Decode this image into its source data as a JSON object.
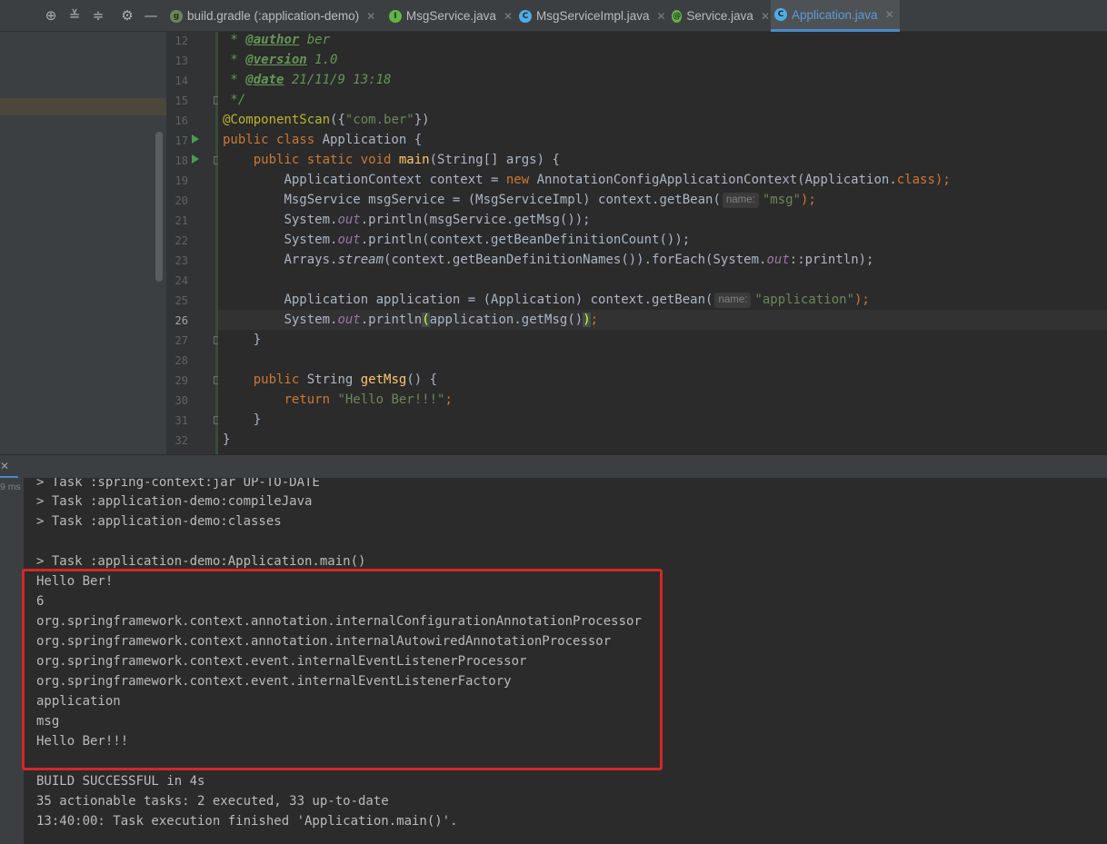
{
  "toolbar": {
    "icons": [
      "target-icon",
      "expand-all-icon",
      "collapse-all-icon",
      "settings-icon",
      "minimize-icon"
    ]
  },
  "tabs": [
    {
      "label": "build.gradle (:application-demo)",
      "icon": "gradle-icon",
      "color": "#6a8759",
      "active": false
    },
    {
      "label": "MsgService.java",
      "icon": "interface-icon",
      "color": "#62b543",
      "active": false
    },
    {
      "label": "MsgServiceImpl.java",
      "icon": "class-icon",
      "color": "#4eade5",
      "active": false
    },
    {
      "label": "Service.java",
      "icon": "annotation-icon",
      "color": "#62b543",
      "active": false
    },
    {
      "label": "Application.java",
      "icon": "class-icon",
      "color": "#4eade5",
      "active": true
    }
  ],
  "editor": {
    "line_numbers": [
      "12",
      "13",
      "14",
      "15",
      "16",
      "17",
      "18",
      "19",
      "20",
      "21",
      "22",
      "23",
      "24",
      "25",
      "26",
      "27",
      "28",
      "29",
      "30",
      "31",
      "32"
    ],
    "current_line": "26",
    "hints": {
      "name": "name:"
    },
    "lines": {
      "l12": {
        "star": " * ",
        "tag": "@author",
        "rest": " ber"
      },
      "l13": {
        "star": " * ",
        "tag": "@version",
        "rest": " 1.0"
      },
      "l14": {
        "star": " * ",
        "tag": "@date",
        "rest": " 21/11/9 13:18"
      },
      "l15": {
        "text": " */"
      },
      "l16": {
        "anno": "@ComponentScan",
        "p1": "({",
        "s": "\"com.ber\"",
        "p2": "})"
      },
      "l17": {
        "k1": "public class ",
        "t": "Application {"
      },
      "l18": {
        "ind": "    ",
        "k1": "public static void ",
        "fn": "main",
        "t": "(String[] args) {"
      },
      "l19": {
        "ind": "        ",
        "a": "ApplicationContext context = ",
        "k": "new ",
        "b": "AnnotationConfigApplicationContext(Application.",
        "k2": "class",
        "c": ");"
      },
      "l20": {
        "ind": "        ",
        "a": "MsgService msgService = (MsgServiceImpl) context.getBean(",
        "s": "\"msg\"",
        "c": ");"
      },
      "l21": {
        "ind": "        ",
        "a": "System.",
        "it": "out",
        "b": ".println(msgService.getMsg());"
      },
      "l22": {
        "ind": "        ",
        "a": "System.",
        "it": "out",
        "b": ".println(context.getBeanDefinitionCount());"
      },
      "l23": {
        "ind": "        ",
        "a": "Arrays.",
        "st": "stream",
        "b": "(context.getBeanDefinitionNames()).forEach(System.",
        "it": "out",
        "c": "::println);"
      },
      "l25": {
        "ind": "        ",
        "a": "Application application = (Application) context.getBean(",
        "s": "\"application\"",
        "c": ");"
      },
      "l26": {
        "ind": "        ",
        "a": "System.",
        "it": "out",
        "b": ".println",
        "p1": "(",
        "c": "application.getMsg()",
        "p2": ")",
        "d": ";"
      },
      "l27": {
        "text": "    }"
      },
      "l29": {
        "ind": "    ",
        "k": "public ",
        "a": "String ",
        "fn": "getMsg",
        "b": "() {"
      },
      "l30": {
        "ind": "        ",
        "k": "return ",
        "s": "\"Hello Ber!!!\"",
        "c": ";"
      },
      "l31": {
        "text": "    }"
      },
      "l32": {
        "text": "}"
      }
    }
  },
  "run_panel": {
    "time": "9 ms",
    "output": [
      "> Task :spring-context:jar UP-TO-DATE",
      "> Task :application-demo:compileJava",
      "> Task :application-demo:classes",
      "",
      "> Task :application-demo:Application.main()",
      "Hello Ber!",
      "6",
      "org.springframework.context.annotation.internalConfigurationAnnotationProcessor",
      "org.springframework.context.annotation.internalAutowiredAnnotationProcessor",
      "org.springframework.context.event.internalEventListenerProcessor",
      "org.springframework.context.event.internalEventListenerFactory",
      "application",
      "msg",
      "Hello Ber!!!",
      "",
      "BUILD SUCCESSFUL in 4s",
      "35 actionable tasks: 2 executed, 33 up-to-date",
      "13:40:00: Task execution finished 'Application.main()'."
    ]
  },
  "colors": {
    "highlight_box": "#d62627",
    "accent": "#4a88c7",
    "run_icon": "#499c54"
  }
}
